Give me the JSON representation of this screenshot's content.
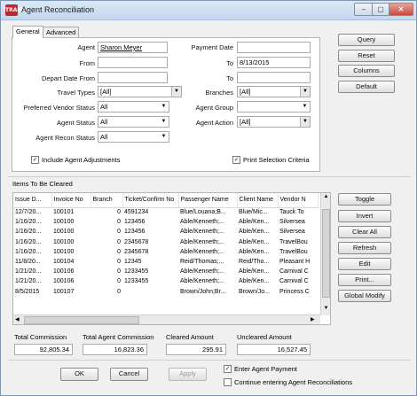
{
  "window": {
    "logo_text": "TRAMS",
    "title": "Agent Reconciliation",
    "minimize": "–",
    "maximize": "▢",
    "close": "✕"
  },
  "tabs": [
    "General",
    "Advanced"
  ],
  "filters": {
    "agent_label": "Agent",
    "agent_value": "Sharon Meyer",
    "payment_date_label": "Payment Date",
    "payment_date_value": "",
    "from_label": "From",
    "from_value": "",
    "to_label": "To",
    "to_value": "8/13/2015",
    "depart_date_from_label": "Depart Date From",
    "depart_date_from_value": "",
    "depart_to_label": "To",
    "depart_to_value": "",
    "travel_types_label": "Travel Types",
    "travel_types_value": "[All]",
    "branches_label": "Branches",
    "branches_value": "[All]",
    "preferred_vendor_status_label": "Preferred Vendor Status",
    "preferred_vendor_status_value": "All",
    "agent_group_label": "Agent Group",
    "agent_group_value": "",
    "agent_status_label": "Agent Status",
    "agent_status_value": "All",
    "agent_action_label": "Agent Action",
    "agent_action_value": "[All]",
    "agent_recon_status_label": "Agent Recon Status",
    "agent_recon_status_value": "All",
    "include_agent_adjustments_label": "Include Agent Adjustments",
    "include_agent_adjustments_checked": true,
    "print_selection_criteria_label": "Print Selection Criteria",
    "print_selection_criteria_checked": true
  },
  "right_buttons": [
    "Query",
    "Reset",
    "Columns",
    "Default"
  ],
  "items_section": {
    "title": "Items To Be Cleared",
    "columns": [
      "Issue D...",
      "Invoice No",
      "Branch",
      "Ticket/Confirm No",
      "Passenger Name",
      "Client Name",
      "Vendor N"
    ],
    "rows": [
      [
        "12/7/20...",
        "100101",
        "0",
        "4591234",
        "Blue/Louana;B...",
        "Blue/Mic...",
        "Tauck To"
      ],
      [
        "1/16/20...",
        "100100",
        "0",
        "123456",
        "Able/Kenneth;...",
        "Able/Ken...",
        "Silversea"
      ],
      [
        "1/16/20...",
        "100100",
        "0",
        "123456",
        "Able/Kenneth;...",
        "Able/Ken...",
        "Silversea"
      ],
      [
        "1/16/20...",
        "100100",
        "0",
        "2345678",
        "Able/Kenneth;...",
        "Able/Ken...",
        "TravelBou"
      ],
      [
        "1/16/20...",
        "100100",
        "0",
        "2345678",
        "Able/Kenneth;...",
        "Able/Ken...",
        "TravelBou"
      ],
      [
        "11/8/20...",
        "100104",
        "0",
        "12345",
        "Reid/Thomas;...",
        "Reid/Tho...",
        "Pleasant H"
      ],
      [
        "1/21/20...",
        "100106",
        "0",
        "1233455",
        "Able/Kenneth;...",
        "Able/Ken...",
        "Carnival C"
      ],
      [
        "1/21/20...",
        "100106",
        "0",
        "1233455",
        "Able/Kenneth;...",
        "Able/Ken...",
        "Carnival C"
      ],
      [
        "8/5/2015",
        "100107",
        "0",
        "",
        "Brown/John;Br...",
        "Brown/Jo...",
        "Princess C"
      ]
    ],
    "buttons": [
      "Toggle",
      "Invert",
      "Clear All",
      "Refresh",
      "Edit",
      "Print...",
      "Global Modify"
    ]
  },
  "summary": {
    "total_commission_label": "Total Commission",
    "total_commission_value": "92,805.34",
    "total_agent_commission_label": "Total Agent Commission",
    "total_agent_commission_value": "16,823.36",
    "cleared_amount_label": "Cleared Amount",
    "cleared_amount_value": "295.91",
    "uncleared_amount_label": "Uncleared Amount",
    "uncleared_amount_value": "16,527.45"
  },
  "footer": {
    "ok": "OK",
    "cancel": "Cancel",
    "apply": "Apply",
    "enter_agent_payment_label": "Enter Agent Payment",
    "enter_agent_payment_checked": true,
    "continue_label": "Continue entering Agent Reconciliations",
    "continue_checked": false
  },
  "colors": {
    "title_bar": "#c4d7ec",
    "logo": "#c0272d",
    "close_button": "#c9483a",
    "window_bg": "#f0f0f0"
  }
}
